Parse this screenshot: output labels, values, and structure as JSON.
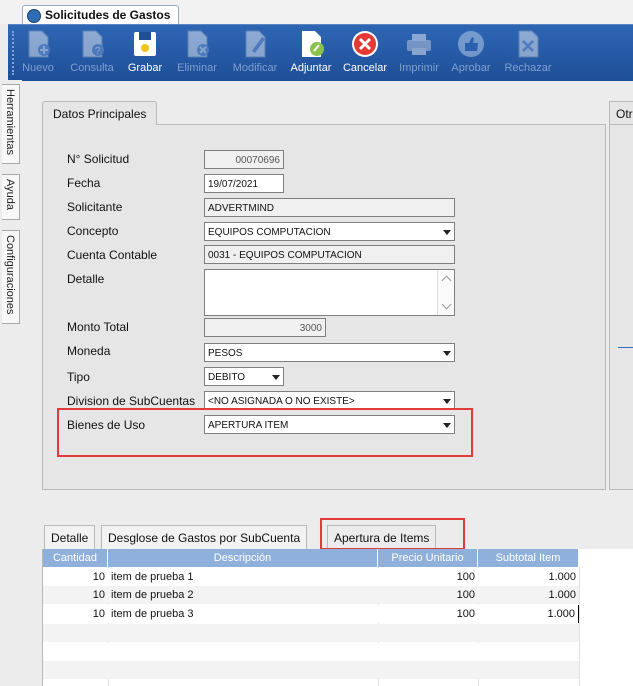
{
  "window": {
    "title": "Solicitudes de Gastos"
  },
  "toolbar": {
    "buttons": [
      {
        "label": "Nuevo",
        "icon": "document-add-icon",
        "enabled": false
      },
      {
        "label": "Consulta",
        "icon": "document-query-icon",
        "enabled": false
      },
      {
        "label": "Grabar",
        "icon": "floppy-save-icon",
        "enabled": true
      },
      {
        "label": "Eliminar",
        "icon": "document-delete-icon",
        "enabled": false
      },
      {
        "label": "Modificar",
        "icon": "document-edit-icon",
        "enabled": false
      },
      {
        "label": "Adjuntar",
        "icon": "attach-icon",
        "enabled": true
      },
      {
        "label": "Cancelar",
        "icon": "cancel-icon",
        "enabled": true
      },
      {
        "label": "Imprimir",
        "icon": "printer-icon",
        "enabled": false
      },
      {
        "label": "Aprobar",
        "icon": "thumbs-up-icon",
        "enabled": false
      },
      {
        "label": "Rechazar",
        "icon": "document-reject-icon",
        "enabled": false
      }
    ]
  },
  "sidebar": {
    "tabs": [
      "Herramientas",
      "Ayuda",
      "Configuraciones"
    ]
  },
  "group": {
    "title": "Datos Principales",
    "other_tab": "Otr"
  },
  "form": {
    "nro_solicitud": {
      "label": "N° Solicitud",
      "value": "00070696"
    },
    "fecha": {
      "label": "Fecha",
      "value": "19/07/2021"
    },
    "solicitante": {
      "label": "Solicitante",
      "value": "ADVERTMIND"
    },
    "concepto": {
      "label": "Concepto",
      "value": "EQUIPOS COMPUTACION"
    },
    "cuenta_contable": {
      "label": "Cuenta Contable",
      "value": "0031 - EQUIPOS COMPUTACION"
    },
    "detalle": {
      "label": "Detalle",
      "value": ""
    },
    "monto_total": {
      "label": "Monto Total",
      "value": "3000"
    },
    "moneda": {
      "label": "Moneda",
      "value": "PESOS"
    },
    "tipo": {
      "label": "Tipo",
      "value": "DEBITO"
    },
    "division": {
      "label": "Division de SubCuentas",
      "value": "<NO ASIGNADA O NO EXISTE>"
    },
    "bienes_de_uso": {
      "label": "Bienes de Uso",
      "value": "APERTURA ITEM"
    }
  },
  "bottom_tabs": [
    "Detalle",
    "Desglose de Gastos por SubCuenta",
    "Apertura de Items"
  ],
  "active_bottom_tab": "Apertura de Items",
  "grid": {
    "columns": [
      "Cantidad",
      "Descripción",
      "Precio Unitario",
      "Subtotal Item"
    ],
    "rows": [
      {
        "cantidad": "10",
        "descripcion": "item de prueba 1",
        "precio": "100",
        "subtotal": "1.000"
      },
      {
        "cantidad": "10",
        "descripcion": "item de prueba 2",
        "precio": "100",
        "subtotal": "1.000"
      },
      {
        "cantidad": "10",
        "descripcion": "item de prueba 3",
        "precio": "100",
        "subtotal": "1.000"
      }
    ]
  },
  "colors": {
    "toolbar": "#2657a6",
    "highlight": "#e03a3a",
    "grid_header": "#8fb0da"
  }
}
